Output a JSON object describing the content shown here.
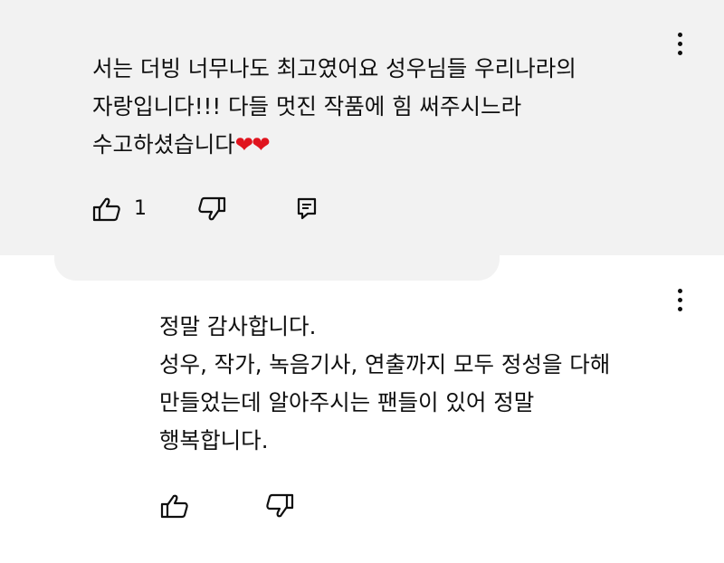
{
  "comment": {
    "lines": [
      "서는 더빙 너무나도 최고였어요 성우님들 우리나라의",
      "자랑입니다!!! 다들 멋진 작품에 힘 써주시느라",
      "수고하셨습니다"
    ],
    "hearts": "❤❤",
    "like_count": "1"
  },
  "reply": {
    "lines": [
      "정말 감사합니다.",
      "성우, 작가, 녹음기사, 연출까지 모두 정성을 다해",
      "만들었는데 알아주시는 팬들이 있어 정말",
      "행복합니다."
    ]
  },
  "colors": {
    "comment_bg": "#f2f2f2",
    "page_bg": "#ffffff",
    "text": "#0f0f0f",
    "heart": "#e0141e"
  },
  "icons": {
    "like": "thumb-up-icon",
    "dislike": "thumb-down-icon",
    "reply": "comment-reply-icon",
    "menu": "more-vertical-icon"
  }
}
